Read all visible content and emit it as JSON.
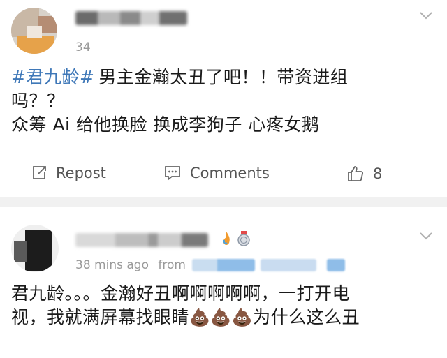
{
  "post1": {
    "time_partial": "34",
    "content_hashtag": "#君九龄#",
    "content_line1_rest": "男主金瀚太丑了吧！！带资进组",
    "content_line2": "吗？？",
    "content_line3": "众筹 Ai 给他换脸  换成李狗子  心疼女鹅",
    "repost_label": "Repost",
    "comments_label": "Comments",
    "like_count": "8"
  },
  "post2": {
    "time": "38 mins ago",
    "from_label": "from",
    "content_line1": "君九龄。。。金瀚好丑啊啊啊啊啊，一打开电",
    "content_line2_pre": "视，我就满屏幕找眼睛",
    "content_line2_emojis": "💩💩💩",
    "content_line2_post": "为什么这么丑"
  },
  "icons": {
    "chevron": "chevron-down-icon",
    "repost": "repost-icon",
    "comment": "comment-icon",
    "like": "thumbs-up-icon"
  },
  "colors": {
    "hashtag": "#3f78b8",
    "meta": "#9a9a9a",
    "separator": "#f1f1f1"
  }
}
